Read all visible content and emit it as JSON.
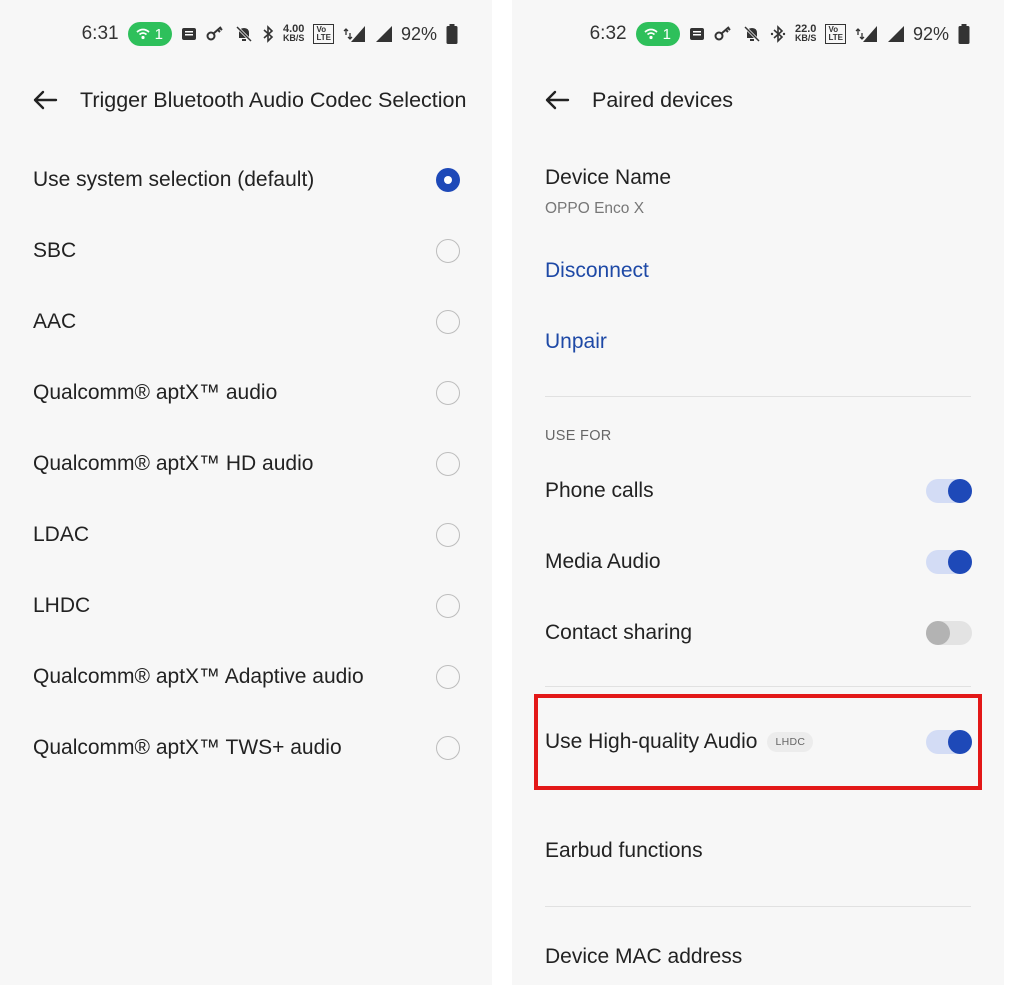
{
  "left_screen": {
    "status_bar": {
      "time": "6:31",
      "hotspot_count": "1",
      "net_speed_value": "4.00",
      "net_speed_unit": "KB/S",
      "volte_top": "Vo",
      "volte_bottom": "LTE",
      "battery": "92%"
    },
    "app_bar": {
      "title": "Trigger Bluetooth Audio Codec Selection"
    },
    "codec_options": [
      {
        "label": "Use system selection (default)",
        "selected": true
      },
      {
        "label": "SBC",
        "selected": false
      },
      {
        "label": "AAC",
        "selected": false
      },
      {
        "label": "Qualcomm® aptX™ audio",
        "selected": false
      },
      {
        "label": "Qualcomm® aptX™ HD audio",
        "selected": false
      },
      {
        "label": "LDAC",
        "selected": false
      },
      {
        "label": "LHDC",
        "selected": false
      },
      {
        "label": "Qualcomm® aptX™ Adaptive audio",
        "selected": false
      },
      {
        "label": "Qualcomm® aptX™ TWS+ audio",
        "selected": false
      }
    ]
  },
  "right_screen": {
    "status_bar": {
      "time": "6:32",
      "hotspot_count": "1",
      "net_speed_value": "22.0",
      "net_speed_unit": "KB/S",
      "volte_top": "Vo",
      "volte_bottom": "LTE",
      "battery": "92%"
    },
    "app_bar": {
      "title": "Paired devices"
    },
    "device": {
      "name_label": "Device Name",
      "name_value": "OPPO Enco X"
    },
    "actions": {
      "disconnect": "Disconnect",
      "unpair": "Unpair"
    },
    "use_for": {
      "header": "USE FOR",
      "items": [
        {
          "label": "Phone calls",
          "enabled": true
        },
        {
          "label": "Media Audio",
          "enabled": true
        },
        {
          "label": "Contact sharing",
          "enabled": false
        }
      ]
    },
    "high_quality": {
      "label": "Use High-quality Audio",
      "tag": "LHDC",
      "enabled": true
    },
    "earbud_functions": "Earbud functions",
    "mac_address_label": "Device MAC address"
  },
  "colors": {
    "accent": "#1e49b8",
    "link": "#1e49a6",
    "hotspot_green": "#2ec05b",
    "highlight_red": "#e31818"
  }
}
